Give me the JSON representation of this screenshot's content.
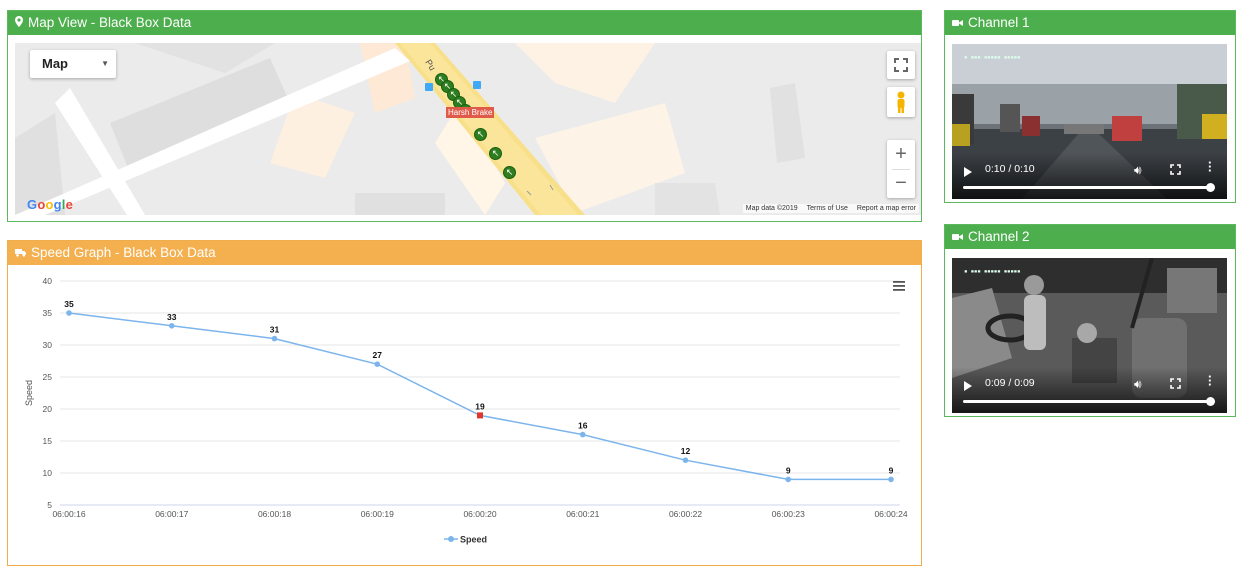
{
  "map_panel": {
    "title": "Map View - Black Box Data",
    "icon": "map-marker-icon"
  },
  "map": {
    "type_label": "Map",
    "marker_label": "Harsh Brake",
    "road_label": "Pu",
    "logo": "Google",
    "footer": [
      "Map data ©2019",
      "Terms of Use",
      "Report a map error"
    ],
    "buttons": [
      "fullscreen-icon",
      "pegman-icon",
      "zoom-in-icon",
      "zoom-out-icon"
    ],
    "zoom_in": "+",
    "zoom_out": "−"
  },
  "speed_panel": {
    "title": "Speed Graph - Black Box Data",
    "icon": "truck-icon",
    "menu_icon": "hamburger-menu-icon"
  },
  "chart_data": {
    "type": "line",
    "title": "",
    "xlabel": "",
    "ylabel": "Speed",
    "ylim": [
      5,
      40
    ],
    "yticks": [
      5,
      10,
      15,
      20,
      25,
      30,
      35,
      40
    ],
    "categories": [
      "06:00:16",
      "06:00:17",
      "06:00:18",
      "06:00:19",
      "06:00:20",
      "06:00:21",
      "06:00:22",
      "06:00:23",
      "06:00:24"
    ],
    "series": [
      {
        "name": "Speed",
        "values": [
          35,
          33,
          31,
          27,
          19,
          16,
          12,
          9,
          9
        ],
        "color": "#7cb5ec",
        "highlight_index": 4,
        "highlight_color": "#e0362c"
      }
    ],
    "grid": true,
    "legend": "bottom-center"
  },
  "channel1": {
    "title": "Channel 1",
    "icon": "video-camera-icon",
    "time": "0:10 / 0:10",
    "progress": 1.0
  },
  "channel2": {
    "title": "Channel 2",
    "icon": "video-camera-icon",
    "time": "0:09 / 0:09",
    "progress": 1.0
  },
  "colors": {
    "green": "#4cae4c",
    "orange": "#f4b04f",
    "line": "#7cb5ec"
  }
}
